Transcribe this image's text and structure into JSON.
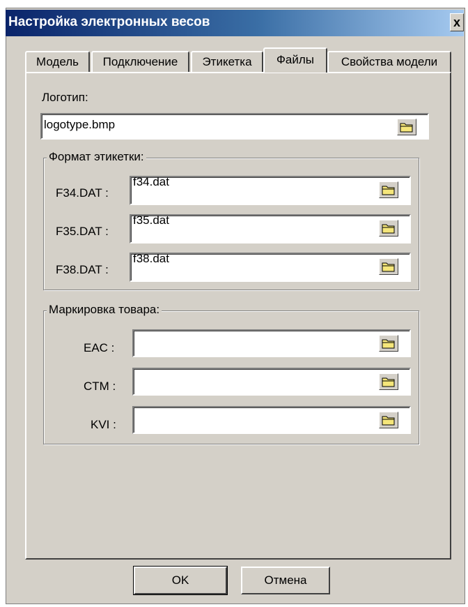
{
  "window": {
    "title": "Настройка электронных весов",
    "close_label": "x"
  },
  "tabs": [
    {
      "label": "Модель"
    },
    {
      "label": "Подключение"
    },
    {
      "label": "Этикетка"
    },
    {
      "label": "Файлы",
      "active": true
    },
    {
      "label": "Свойства модели"
    }
  ],
  "logo": {
    "label": "Логотип:",
    "value": "logotype.bmp"
  },
  "label_format": {
    "legend": "Формат этикетки:",
    "rows": [
      {
        "label": "F34.DAT :",
        "value": "f34.dat"
      },
      {
        "label": "F35.DAT :",
        "value": "f35.dat"
      },
      {
        "label": "F38.DAT :",
        "value": "f38.dat"
      }
    ]
  },
  "marking": {
    "legend": "Маркировка товара:",
    "rows": [
      {
        "label": "EAC :",
        "value": ""
      },
      {
        "label": "CTM :",
        "value": ""
      },
      {
        "label": "KVI :",
        "value": ""
      }
    ]
  },
  "buttons": {
    "ok": "OK",
    "cancel": "Отмена"
  },
  "icons": {
    "browse": "folder-icon",
    "close": "close-icon"
  },
  "colors": {
    "title_start": "#0a246a",
    "title_end": "#a6caf0",
    "face": "#d4d0c8",
    "folder": "#f5e67a"
  }
}
